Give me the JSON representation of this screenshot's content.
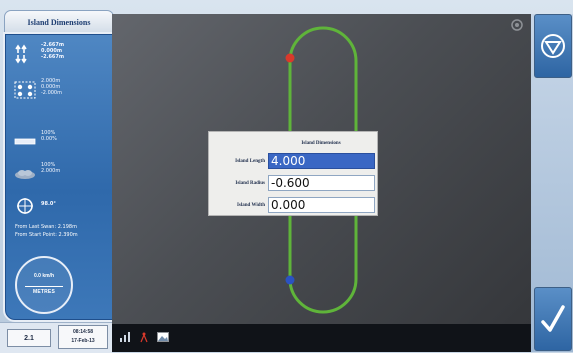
{
  "window": {
    "title": "Island Dimensions"
  },
  "left_panel": {
    "row1": {
      "icon": "rows-arrows-icon",
      "values": [
        "-2.667m",
        "0.000m",
        "-2.667m"
      ]
    },
    "row2": {
      "icon": "grid-dots-icon",
      "values": [
        "2.000m",
        "0.000m",
        "-2.000m"
      ]
    },
    "row3": {
      "icon": "bar-icon",
      "values": [
        "100%",
        "0.00%"
      ]
    },
    "row4": {
      "icon": "cloud-icon",
      "values": [
        "100%",
        "2.000m"
      ]
    },
    "row5": {
      "icon": "crosshair-icon",
      "value": "98.0°"
    },
    "from_last_swan": "From Last Swan: 2.198m",
    "from_start_point": "From Start Point: 2.390m",
    "speed": {
      "value": "0.0 km/h",
      "units": "METRES"
    }
  },
  "status": {
    "left_value": "2.1",
    "time": "08:14:58",
    "date": "17-Feb-13"
  },
  "main": {
    "track": {
      "color": "#5fb43a",
      "start_marker_color": "#d9392b",
      "end_marker_color": "#2b52c2"
    }
  },
  "dialog": {
    "header": "Island Dimensions",
    "rows": [
      {
        "label": "Island Length",
        "value": "4.000",
        "selected": true
      },
      {
        "label": "Island Radius",
        "value": "-0.600",
        "selected": false
      },
      {
        "label": "Island Width",
        "value": "0.000",
        "selected": false
      }
    ]
  },
  "right_panel": {
    "top_button": {
      "icon": "down-triangle-circle-icon"
    },
    "bottom_button": {
      "icon": "checkmark-icon"
    }
  },
  "bottom_strip": {
    "icons": [
      "signal-icon",
      "radio-tower-icon",
      "image-icon"
    ]
  },
  "colors": {
    "accent": "#2f69ab",
    "selected": "#3a67c4"
  }
}
